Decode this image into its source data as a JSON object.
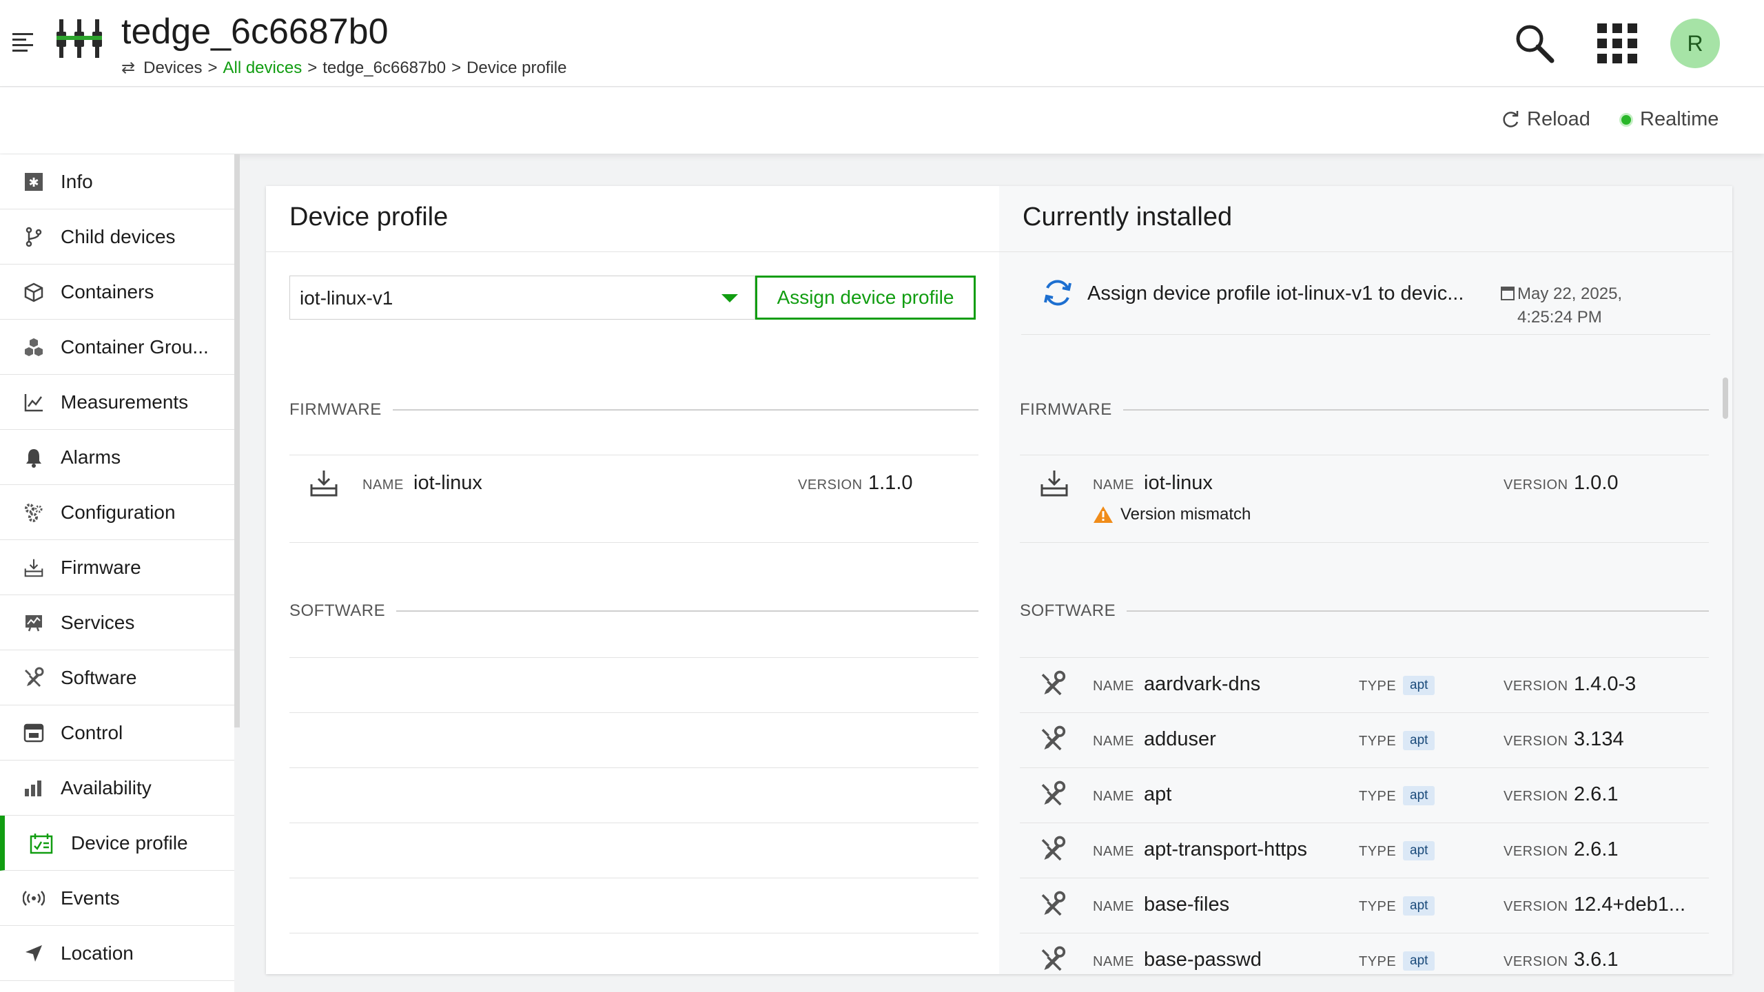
{
  "header": {
    "title": "tedge_6c6687b0",
    "breadcrumb": [
      "Devices",
      ">",
      "All devices",
      ">",
      "tedge_6c6687b0",
      ">",
      "Device profile"
    ],
    "avatar_letter": "R"
  },
  "actionbar": {
    "reload_label": "Reload",
    "realtime_label": "Realtime"
  },
  "sidebar": {
    "items": [
      {
        "label": "Info",
        "icon": "info-icon"
      },
      {
        "label": "Child devices",
        "icon": "branch-icon"
      },
      {
        "label": "Containers",
        "icon": "cube-icon"
      },
      {
        "label": "Container Grou...",
        "icon": "cubes-icon"
      },
      {
        "label": "Measurements",
        "icon": "line-chart-icon"
      },
      {
        "label": "Alarms",
        "icon": "bell-icon"
      },
      {
        "label": "Configuration",
        "icon": "gears-icon"
      },
      {
        "label": "Firmware",
        "icon": "firmware-icon"
      },
      {
        "label": "Services",
        "icon": "services-icon"
      },
      {
        "label": "Software",
        "icon": "tools-icon"
      },
      {
        "label": "Control",
        "icon": "control-icon"
      },
      {
        "label": "Availability",
        "icon": "bar-chart-icon"
      },
      {
        "label": "Device profile",
        "icon": "device-profile-icon",
        "active": true
      },
      {
        "label": "Events",
        "icon": "broadcast-icon"
      },
      {
        "label": "Location",
        "icon": "location-arrow-icon"
      }
    ]
  },
  "left": {
    "title": "Device profile",
    "select_value": "iot-linux-v1",
    "assign_label": "Assign device profile",
    "firmware_section": "FIRMWARE",
    "software_section": "SOFTWARE",
    "firmware": {
      "name_label": "NAME",
      "name": "iot-linux",
      "version_label": "VERSION",
      "version": "1.1.0"
    }
  },
  "right": {
    "title": "Currently installed",
    "operation": {
      "text": "Assign device profile iot-linux-v1 to devic...",
      "date_line1": "May 22, 2025,",
      "date_line2": "4:25:24 PM"
    },
    "firmware_section": "FIRMWARE",
    "software_section": "SOFTWARE",
    "firmware": {
      "name_label": "NAME",
      "name": "iot-linux",
      "version_label": "VERSION",
      "version": "1.0.0",
      "warning": "Version mismatch"
    },
    "software_labels": {
      "name": "NAME",
      "type": "TYPE",
      "version": "VERSION"
    },
    "software": [
      {
        "name": "aardvark-dns",
        "type": "apt",
        "version": "1.4.0-3"
      },
      {
        "name": "adduser",
        "type": "apt",
        "version": "3.134"
      },
      {
        "name": "apt",
        "type": "apt",
        "version": "2.6.1"
      },
      {
        "name": "apt-transport-https",
        "type": "apt",
        "version": "2.6.1"
      },
      {
        "name": "base-files",
        "type": "apt",
        "version": "12.4+deb1..."
      },
      {
        "name": "base-passwd",
        "type": "apt",
        "version": "3.6.1"
      }
    ]
  },
  "colors": {
    "accent": "#119d11",
    "avatar_bg": "#a6e3a6",
    "badge_bg": "#dbe8f6",
    "warning": "#f08c1a",
    "refresh": "#1d6fd0"
  }
}
